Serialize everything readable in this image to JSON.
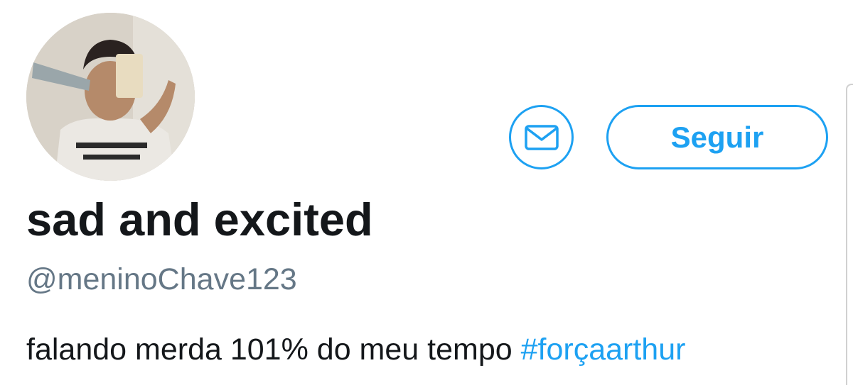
{
  "profile": {
    "avatar_icon": "profile-photo",
    "display_name": "sad and excited",
    "handle": "@meninoChave123",
    "bio": {
      "text": "falando merda 101% do meu tempo ",
      "hashtag": "#forçaarthur"
    }
  },
  "actions": {
    "message_icon": "envelope-icon",
    "follow_label": "Seguir"
  },
  "colors": {
    "accent": "#1da1f2",
    "text_primary": "#14171a",
    "text_secondary": "#657786"
  }
}
